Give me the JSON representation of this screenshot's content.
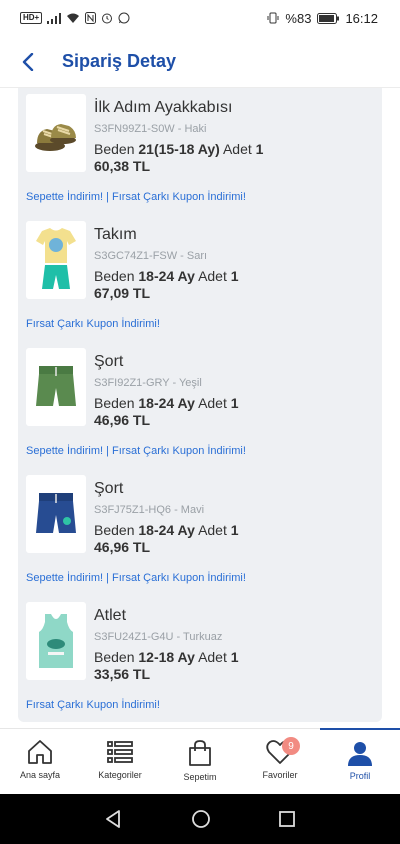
{
  "status_bar": {
    "hd": "HD+",
    "battery": "%83",
    "time": "16:12"
  },
  "header": {
    "title": "Sipariş Detay"
  },
  "items": [
    {
      "name": "İlk Adım Ayakkabısı",
      "code": "S3FN99Z1-S0W - Haki",
      "size_label": "Beden",
      "size": "21(15-18 Ay)",
      "qty_label": "Adet",
      "qty": "1",
      "price": "60,38 TL",
      "promo": "Sepette İndirim! | Fırsat Çarkı Kupon İndirimi!",
      "icon": "shoe-icon"
    },
    {
      "name": "Takım",
      "code": "S3GC74Z1-FSW - Sarı",
      "size_label": "Beden",
      "size": "18-24 Ay",
      "qty_label": "Adet",
      "qty": "1",
      "price": "67,09 TL",
      "promo": "Fırsat Çarkı Kupon İndirimi!",
      "icon": "outfit-icon"
    },
    {
      "name": "Şort",
      "code": "S3FI92Z1-GRY - Yeşil",
      "size_label": "Beden",
      "size": "18-24 Ay",
      "qty_label": "Adet",
      "qty": "1",
      "price": "46,96 TL",
      "promo": "Sepette İndirim! | Fırsat Çarkı Kupon İndirimi!",
      "icon": "shorts-icon"
    },
    {
      "name": "Şort",
      "code": "S3FJ75Z1-HQ6 - Mavi",
      "size_label": "Beden",
      "size": "18-24 Ay",
      "qty_label": "Adet",
      "qty": "1",
      "price": "46,96 TL",
      "promo": "Sepette İndirim! | Fırsat Çarkı Kupon İndirimi!",
      "icon": "shorts-icon"
    },
    {
      "name": "Atlet",
      "code": "S3FU24Z1-G4U - Turkuaz",
      "size_label": "Beden",
      "size": "12-18 Ay",
      "qty_label": "Adet",
      "qty": "1",
      "price": "33,56 TL",
      "promo": "Fırsat Çarkı Kupon İndirimi!",
      "icon": "tank-top-icon"
    }
  ],
  "tabs": [
    {
      "label": "Ana sayfa",
      "icon": "home-icon"
    },
    {
      "label": "Kategoriler",
      "icon": "categories-icon"
    },
    {
      "label": "Sepetim",
      "icon": "cart-icon"
    },
    {
      "label": "Favoriler",
      "icon": "heart-icon",
      "badge": "9"
    },
    {
      "label": "Profil",
      "icon": "profile-icon",
      "active": true
    }
  ],
  "colors": {
    "accent": "#1e4fa8",
    "promo": "#2a6fd6",
    "badge": "#f28b82"
  }
}
